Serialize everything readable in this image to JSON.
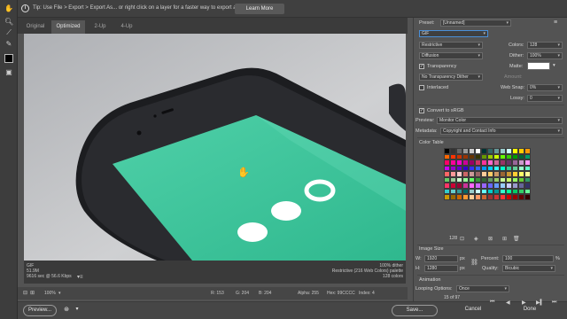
{
  "tipbar": {
    "tip_text": "Tip: Use File > Export > Export As...  or right click on a layer for a faster way to export assets",
    "learn_more": "Learn More"
  },
  "tools": [
    "hand-tool",
    "zoom-tool",
    "slice-select-tool",
    "eyedropper-tool",
    "toggle-slices-tool"
  ],
  "tabs": [
    {
      "label": "Original"
    },
    {
      "label": "Optimized"
    },
    {
      "label": "2-Up"
    },
    {
      "label": "4-Up"
    }
  ],
  "image_info": {
    "format": "GIF",
    "size": "51.9M",
    "time": "9616 sec @ 56.6 Kbps",
    "dither": "100% dither",
    "palette": "Restrictive (216 Web Colors) palette",
    "colors": "128 colors"
  },
  "status": {
    "zoom": "100%",
    "r": "R: 153",
    "g": "G: 204",
    "b": "B: 204",
    "alpha": "Alpha: 255",
    "hex": "Hex: 99CCCC",
    "index": "Index: 4"
  },
  "buttons": {
    "preview": "Preview...",
    "save": "Save...",
    "cancel": "Cancel",
    "done": "Done"
  },
  "settings": {
    "preset_label": "Preset:",
    "preset_value": "[Unnamed]",
    "format": "GIF",
    "reduction": "Restrictive",
    "colors_label": "Colors:",
    "colors_value": "128",
    "dither_algo": "Diffusion",
    "dither_label": "Dither:",
    "dither_value": "100%",
    "transparency": "Transparency",
    "matte_label": "Matte:",
    "trans_dither": "No Transparency Dither",
    "amount_label": "Amount:",
    "interlaced": "Interlaced",
    "websnap_label": "Web Snap:",
    "websnap_value": "0%",
    "lossy_label": "Lossy:",
    "lossy_value": "0",
    "convert_srgb": "Convert to sRGB",
    "preview_label": "Preview:",
    "preview_value": "Monitor Color",
    "metadata_label": "Metadata:",
    "metadata_value": "Copyright and Contact Info"
  },
  "color_table": {
    "title": "Color Table",
    "count": "128",
    "colors": [
      "#000000",
      "#333333",
      "#666666",
      "#999999",
      "#cccccc",
      "#ffffff",
      "#003333",
      "#336666",
      "#669999",
      "#99cccc",
      "#ccffff",
      "#ffff00",
      "#ffcc00",
      "#ff9900",
      "#ff6600",
      "#ff3300",
      "#cc3300",
      "#993300",
      "#663300",
      "#333300",
      "#669900",
      "#99cc00",
      "#ccff00",
      "#66ff00",
      "#33cc00",
      "#009900",
      "#006633",
      "#009966",
      "#ff0066",
      "#ff0099",
      "#ff00cc",
      "#cc0099",
      "#990066",
      "#cc3366",
      "#ff3399",
      "#ff66cc",
      "#cc6699",
      "#993366",
      "#663366",
      "#996699",
      "#cc99cc",
      "#ff99ff",
      "#cc00ff",
      "#9900cc",
      "#6600cc",
      "#3300cc",
      "#3333ff",
      "#3366ff",
      "#0099ff",
      "#00ccff",
      "#33ffff",
      "#00ffcc",
      "#33cc99",
      "#66cc99",
      "#99ffcc",
      "#66ffcc",
      "#ff6666",
      "#ff9999",
      "#ffcccc",
      "#cc6666",
      "#cc9999",
      "#996666",
      "#ffcc99",
      "#ffcc66",
      "#cc9966",
      "#996633",
      "#cc9933",
      "#ffcc33",
      "#ffff66",
      "#ffff99",
      "#66cc66",
      "#99cc99",
      "#ccffcc",
      "#99ff99",
      "#66ff66",
      "#339933",
      "#336633",
      "#669966",
      "#99cc66",
      "#ccff99",
      "#ccff66",
      "#99ff66",
      "#66cc33",
      "#339966",
      "#ff3366",
      "#cc0033",
      "#990033",
      "#cc3399",
      "#ff66ff",
      "#cc66ff",
      "#9966ff",
      "#6666ff",
      "#6699ff",
      "#99ccff",
      "#ccccff",
      "#9999cc",
      "#666699",
      "#333366",
      "#33cccc",
      "#66cccc",
      "#339999",
      "#006666",
      "#99cccc",
      "#ccffff",
      "#66ffff",
      "#00cccc",
      "#009999",
      "#33ffcc",
      "#00ff99",
      "#00cc66",
      "#33cc66",
      "#66ff99",
      "#cc9900",
      "#996600",
      "#cc6600",
      "#ff9933",
      "#ffcc99",
      "#ff9966",
      "#cc6633",
      "#993333",
      "#cc3333",
      "#ff3333",
      "#cc0000",
      "#990000",
      "#660000",
      "#330000"
    ]
  },
  "image_size": {
    "title": "Image Size",
    "w_label": "W:",
    "w_value": "1920",
    "h_label": "H:",
    "h_value": "1280",
    "unit": "px",
    "percent_label": "Percent:",
    "percent_value": "100",
    "percent_unit": "%",
    "quality_label": "Quality:",
    "quality_value": "Bicubic"
  },
  "animation": {
    "title": "Animation",
    "looping_label": "Looping Options:",
    "looping_value": "Once",
    "frame": "15 of 97"
  },
  "colors_ui": {
    "phone_screen": "#3cc39a",
    "phone_body": "#1e1f22",
    "background": "#c4c5c7"
  }
}
